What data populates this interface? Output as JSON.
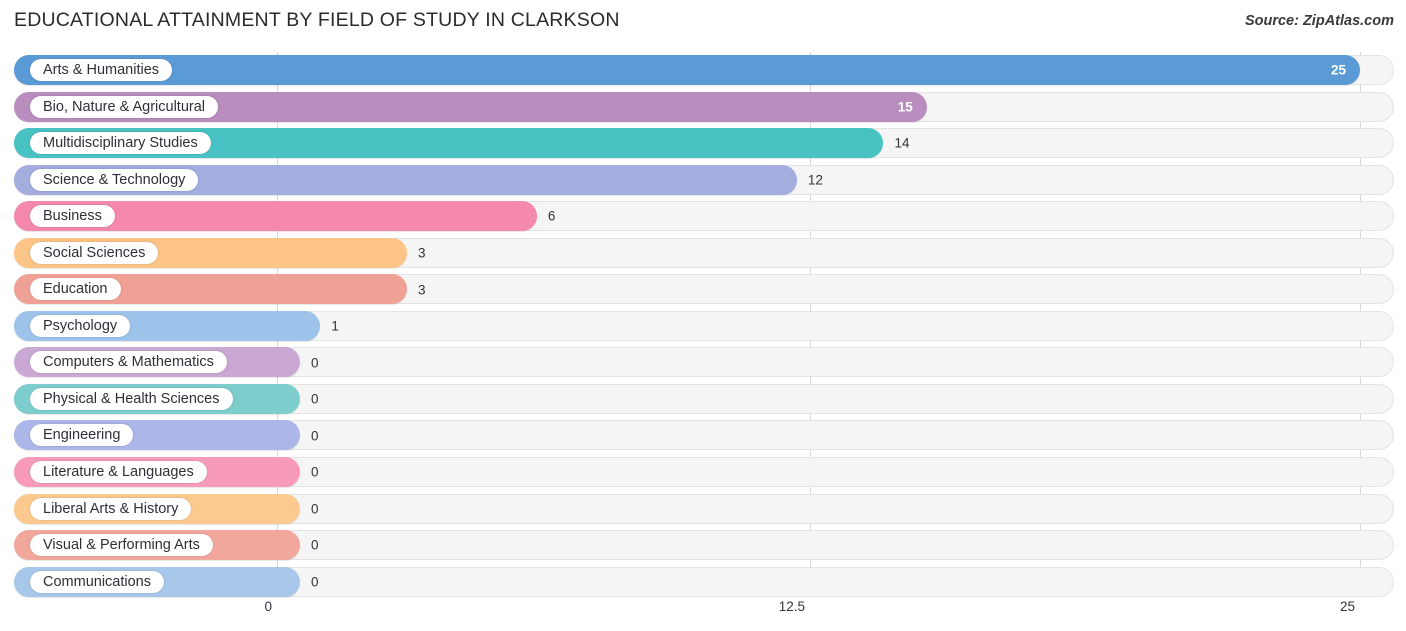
{
  "header": {
    "title": "EDUCATIONAL ATTAINMENT BY FIELD OF STUDY IN CLARKSON",
    "source": "Source: ZipAtlas.com"
  },
  "chart_data": {
    "type": "bar",
    "orientation": "horizontal",
    "title": "EDUCATIONAL ATTAINMENT BY FIELD OF STUDY IN CLARKSON",
    "xlabel": "",
    "ylabel": "",
    "xlim": [
      0,
      25
    ],
    "grid": true,
    "legend": "none",
    "xticks": [
      "0",
      "12.5",
      "25"
    ],
    "xtick_values": [
      0,
      12.5,
      25
    ],
    "categories": [
      "Arts & Humanities",
      "Bio, Nature & Agricultural",
      "Multidisciplinary Studies",
      "Science & Technology",
      "Business",
      "Social Sciences",
      "Education",
      "Psychology",
      "Computers & Mathematics",
      "Physical & Health Sciences",
      "Engineering",
      "Literature & Languages",
      "Liberal Arts & History",
      "Visual & Performing Arts",
      "Communications"
    ],
    "values": [
      25,
      15,
      14,
      12,
      6,
      3,
      3,
      1,
      0,
      0,
      0,
      0,
      0,
      0,
      0
    ],
    "value_labels": [
      "25",
      "15",
      "14",
      "12",
      "6",
      "3",
      "3",
      "1",
      "0",
      "0",
      "0",
      "0",
      "0",
      "0",
      "0"
    ],
    "colors": [
      "#5b9bd5",
      "#b98dbe",
      "#49c2c4",
      "#a3adde",
      "#f589ab",
      "#fcc486",
      "#f0a196",
      "#9dc3ea",
      "#c9a8d4",
      "#7ecdcd",
      "#adb6e8",
      "#f89bb9",
      "#fcc98f",
      "#f2a79d",
      "#a7c8ea"
    ]
  },
  "axis": {
    "ticks": [
      {
        "label": "0",
        "pos": 277
      },
      {
        "label": "12.5",
        "pos": 810
      },
      {
        "label": "25",
        "pos": 1360
      }
    ]
  },
  "colors": {
    "track_bg": "#f5f5f5",
    "track_border": "#e3e3e3",
    "gridline": "#d8d8d8",
    "text": "#33333b"
  }
}
